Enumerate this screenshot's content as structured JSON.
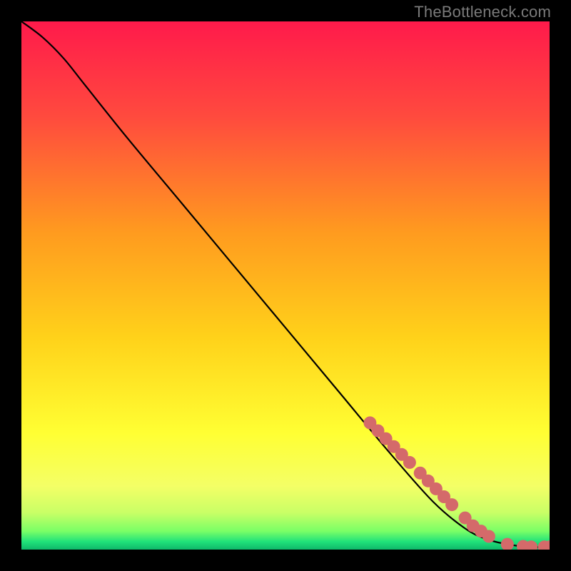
{
  "watermark": "TheBottleneck.com",
  "chart_data": {
    "type": "line",
    "title": "",
    "xlabel": "",
    "ylabel": "",
    "xlim": [
      0,
      100
    ],
    "ylim": [
      0,
      100
    ],
    "grid": false,
    "legend": false,
    "series": [
      {
        "name": "bottleneck-curve",
        "x": [
          0,
          4,
          8,
          12,
          20,
          30,
          40,
          50,
          60,
          70,
          78,
          84,
          88,
          92,
          96,
          100
        ],
        "y": [
          100,
          97,
          93,
          88,
          78,
          66,
          54,
          42,
          30,
          18,
          9,
          4,
          2,
          1,
          0.5,
          0.5
        ]
      }
    ],
    "markers": {
      "name": "highlight-dots",
      "color": "#d46a6a",
      "radius_px": 9,
      "points": [
        {
          "x": 66,
          "y": 24
        },
        {
          "x": 67.5,
          "y": 22.5
        },
        {
          "x": 69,
          "y": 21
        },
        {
          "x": 70.5,
          "y": 19.5
        },
        {
          "x": 72,
          "y": 18
        },
        {
          "x": 73.5,
          "y": 16.5
        },
        {
          "x": 75.5,
          "y": 14.5
        },
        {
          "x": 77,
          "y": 13
        },
        {
          "x": 78.5,
          "y": 11.5
        },
        {
          "x": 80,
          "y": 10
        },
        {
          "x": 81.5,
          "y": 8.5
        },
        {
          "x": 84,
          "y": 6
        },
        {
          "x": 85.5,
          "y": 4.5
        },
        {
          "x": 87,
          "y": 3.5
        },
        {
          "x": 88.5,
          "y": 2.5
        },
        {
          "x": 92,
          "y": 1
        },
        {
          "x": 95,
          "y": 0.6
        },
        {
          "x": 96.5,
          "y": 0.5
        },
        {
          "x": 99,
          "y": 0.5
        },
        {
          "x": 100,
          "y": 0.5
        }
      ]
    },
    "gradient_stops": [
      {
        "pct": 0,
        "color": "#ff1a4b"
      },
      {
        "pct": 18,
        "color": "#ff4a3e"
      },
      {
        "pct": 40,
        "color": "#ff9b1f"
      },
      {
        "pct": 60,
        "color": "#ffd21a"
      },
      {
        "pct": 78,
        "color": "#ffff33"
      },
      {
        "pct": 88,
        "color": "#f4ff66"
      },
      {
        "pct": 93,
        "color": "#c9ff66"
      },
      {
        "pct": 96.5,
        "color": "#7aff66"
      },
      {
        "pct": 98.5,
        "color": "#20e27a"
      },
      {
        "pct": 100,
        "color": "#0fb86a"
      }
    ]
  }
}
